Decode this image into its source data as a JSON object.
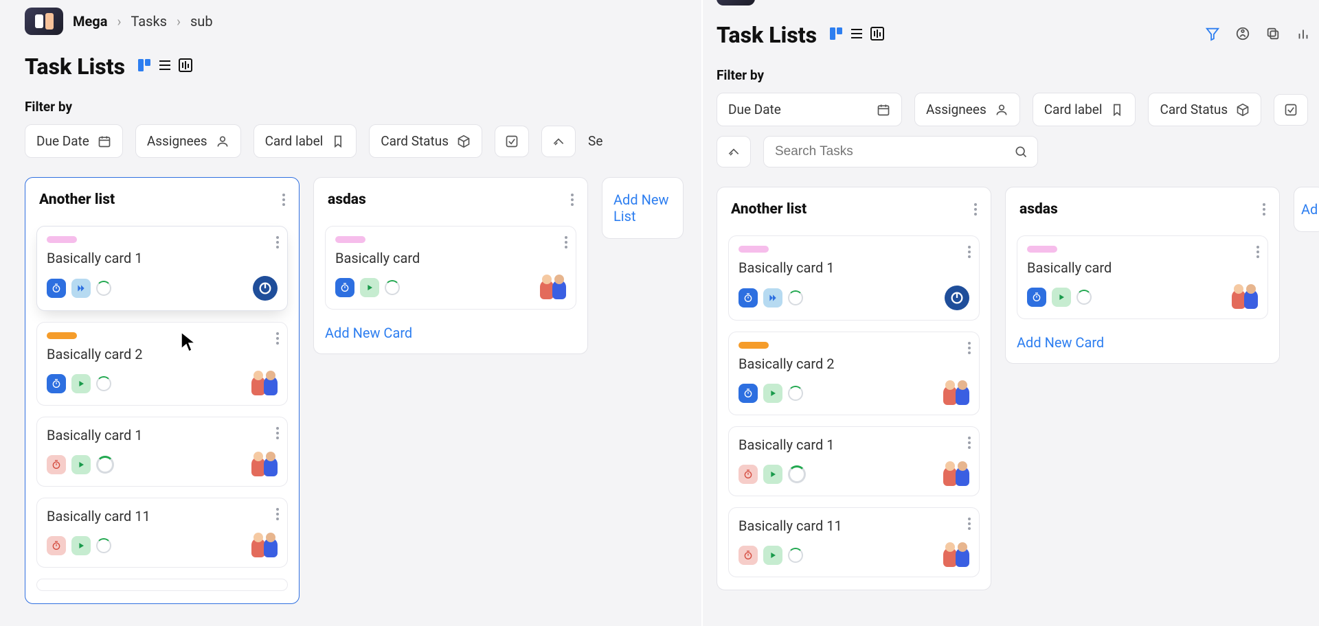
{
  "breadcrumb": {
    "workspace": "Mega",
    "section": "Tasks",
    "sub": "sub"
  },
  "page_title": "Task Lists",
  "filter_label": "Filter by",
  "filters": {
    "due_date": "Due Date",
    "assignees": "Assignees",
    "card_label": "Card label",
    "card_status": "Card Status"
  },
  "search_partial_left": "Se",
  "search_placeholder": "Search Tasks",
  "add_new_list": "Add New List",
  "add_new_list_partial": "Ad",
  "add_new_card": "Add New Card",
  "left": {
    "lists": [
      {
        "title": "Another list",
        "selected": true,
        "cards": [
          {
            "title": "Basically card 1",
            "label": "pink",
            "timer": "blue",
            "play": "lblue",
            "ring": "small",
            "right": "power",
            "lifted": true
          },
          {
            "title": "Basically card 2",
            "label": "orange",
            "timer": "blue",
            "play": "green",
            "ring": "small",
            "right": "avatar",
            "lifted": false
          },
          {
            "title": "Basically card 1",
            "label": null,
            "timer": "red",
            "play": "green",
            "ring": "big",
            "right": "avatar",
            "lifted": false
          },
          {
            "title": "Basically card 11",
            "label": null,
            "timer": "red",
            "play": "green",
            "ring": "small",
            "right": "avatar",
            "lifted": false
          }
        ]
      },
      {
        "title": "asdas",
        "cards": [
          {
            "title": "Basically card",
            "label": "pink",
            "timer": "blue",
            "play": "green",
            "ring": "small",
            "right": "avatar",
            "lifted": false
          }
        ]
      }
    ]
  },
  "right": {
    "lists": [
      {
        "title": "Another list",
        "cards": [
          {
            "title": "Basically card 1",
            "label": "pink",
            "timer": "blue",
            "play": "lblue",
            "ring": "small",
            "right": "power",
            "lifted": false
          },
          {
            "title": "Basically card 2",
            "label": "orange",
            "timer": "blue",
            "play": "green",
            "ring": "small",
            "right": "avatar",
            "lifted": false
          },
          {
            "title": "Basically card 1",
            "label": null,
            "timer": "red",
            "play": "green",
            "ring": "big",
            "right": "avatar",
            "lifted": false
          },
          {
            "title": "Basically card 11",
            "label": null,
            "timer": "red",
            "play": "green",
            "ring": "small",
            "right": "avatar",
            "lifted": false
          }
        ]
      },
      {
        "title": "asdas",
        "cards": [
          {
            "title": "Basically card",
            "label": "pink",
            "timer": "blue",
            "play": "green",
            "ring": "small",
            "right": "avatar",
            "lifted": false
          }
        ]
      }
    ]
  },
  "colors": {
    "accent": "#2d7ef0"
  }
}
